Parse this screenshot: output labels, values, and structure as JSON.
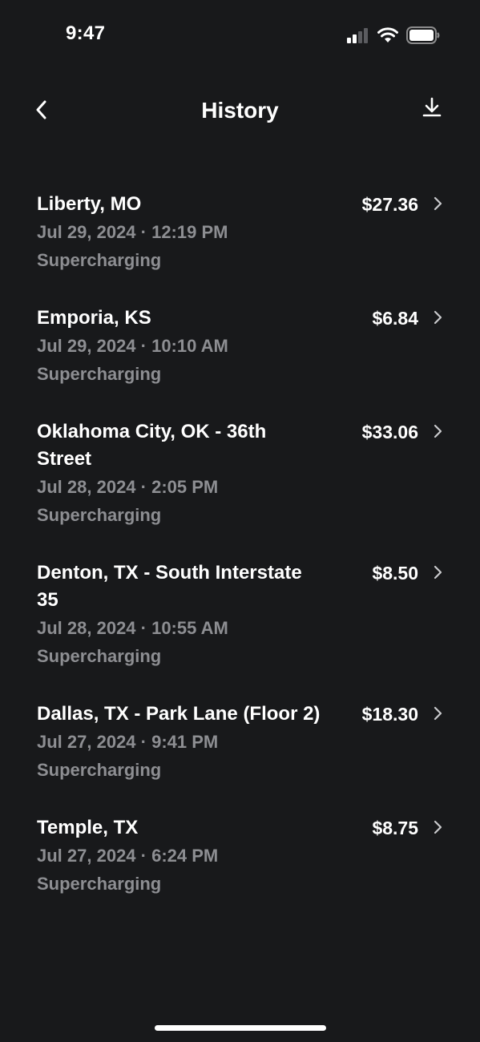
{
  "status_bar": {
    "time": "9:47",
    "icons": [
      "cellular-signal-icon",
      "wifi-icon",
      "battery-icon"
    ]
  },
  "header": {
    "title": "History",
    "back_icon": "chevron-left-icon",
    "action_icon": "download-icon"
  },
  "history": {
    "items": [
      {
        "location": "Liberty, MO",
        "datetime": "Jul 29, 2024 · 12:19 PM",
        "type": "Supercharging",
        "amount": "$27.36"
      },
      {
        "location": "Emporia, KS",
        "datetime": "Jul 29, 2024 · 10:10 AM",
        "type": "Supercharging",
        "amount": "$6.84"
      },
      {
        "location": "Oklahoma City, OK - 36th Street",
        "datetime": "Jul 28, 2024 · 2:05 PM",
        "type": "Supercharging",
        "amount": "$33.06"
      },
      {
        "location": "Denton, TX - South Interstate 35",
        "datetime": "Jul 28, 2024 · 10:55 AM",
        "type": "Supercharging",
        "amount": "$8.50"
      },
      {
        "location": "Dallas, TX - Park Lane (Floor 2)",
        "datetime": "Jul 27, 2024 · 9:41 PM",
        "type": "Supercharging",
        "amount": "$18.30"
      },
      {
        "location": "Temple, TX",
        "datetime": "Jul 27, 2024 · 6:24 PM",
        "type": "Supercharging",
        "amount": "$8.75"
      }
    ]
  },
  "colors": {
    "background": "#18191b",
    "primary_text": "#ffffff",
    "secondary_text": "#8d8e92"
  }
}
